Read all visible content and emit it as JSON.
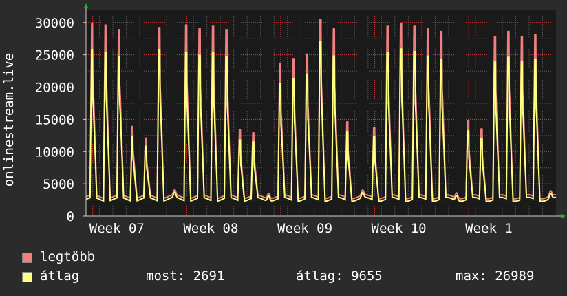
{
  "chart_data": {
    "type": "line",
    "ylabel": "onlinestream.live",
    "yticks": [
      0,
      5000,
      10000,
      15000,
      20000,
      25000,
      30000
    ],
    "ylim": [
      0,
      32000
    ],
    "xticks": [
      "Week 07",
      "Week 08",
      "Week 09",
      "Week 10",
      "Week 1"
    ],
    "grid": true,
    "days": 35,
    "series": [
      {
        "name": "legtöbb",
        "color": "#f08080",
        "daily_peaks": [
          29500,
          29200,
          28500,
          13500,
          11700,
          28800,
          29200,
          28600,
          29000,
          28500,
          13000,
          12500,
          23300,
          24000,
          24700,
          30000,
          28600,
          14200,
          13300,
          29000,
          29500,
          29000,
          28600,
          28200,
          14400,
          13100,
          27400,
          28200,
          27400,
          27700
        ]
      },
      {
        "name": "átlag",
        "color": "#ffff80",
        "daily_peaks": [
          25800,
          25300,
          24700,
          12300,
          10800,
          25800,
          25400,
          24900,
          25300,
          24700,
          11800,
          11500,
          20600,
          21300,
          22000,
          26989,
          24800,
          13000,
          12300,
          25300,
          25900,
          25500,
          24800,
          24300,
          13200,
          12000,
          24000,
          24600,
          24000,
          24300
        ]
      }
    ],
    "stats": {
      "most": "most: 2691",
      "atlag": "átlag: 9655",
      "max": "max: 26989"
    }
  },
  "legend": {
    "item1": "legtöbb",
    "item2": "átlag",
    "most": "most: 2691",
    "atlag": "átlag: 9655",
    "max": "max: 26989"
  },
  "colors": {
    "max": "#f08080",
    "avg": "#ffff80",
    "bg": "#2b2b2b",
    "plot": "#1a1a1a",
    "grid": "#5a5a5a",
    "major_grid": "#d04040"
  }
}
